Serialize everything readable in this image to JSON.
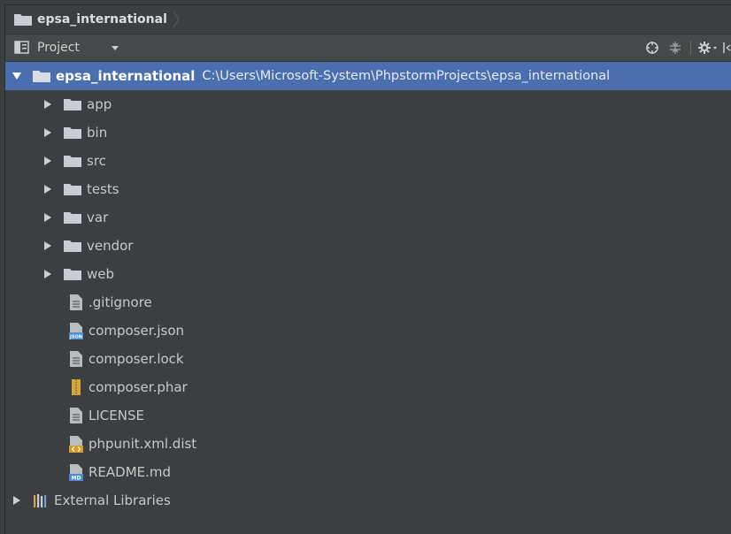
{
  "navbar": {
    "breadcrumb": "epsa_international"
  },
  "tool_window": {
    "view_label": "Project"
  },
  "tree": {
    "root": {
      "label": "epsa_international",
      "path": "C:\\Users\\Microsoft-System\\PhpstormProjects\\epsa_international"
    },
    "folders": [
      "app",
      "bin",
      "src",
      "tests",
      "var",
      "vendor",
      "web"
    ],
    "files": [
      {
        "label": ".gitignore",
        "icon": "text-file-icon"
      },
      {
        "label": "composer.json",
        "icon": "json-file-icon"
      },
      {
        "label": "composer.lock",
        "icon": "text-file-icon"
      },
      {
        "label": "composer.phar",
        "icon": "archive-file-icon"
      },
      {
        "label": "LICENSE",
        "icon": "text-file-icon"
      },
      {
        "label": "phpunit.xml.dist",
        "icon": "xml-file-icon"
      },
      {
        "label": "README.md",
        "icon": "markdown-file-icon"
      }
    ],
    "external_libraries": "External Libraries"
  },
  "colors": {
    "background": "#3c3f41",
    "selection": "#4b6eaf",
    "folder": "#c9cdd3",
    "json_badge": "#4e8bd1",
    "xml_badge": "#d49a2a",
    "md_badge": "#4e8bd1",
    "archive": "#d6a53a"
  }
}
